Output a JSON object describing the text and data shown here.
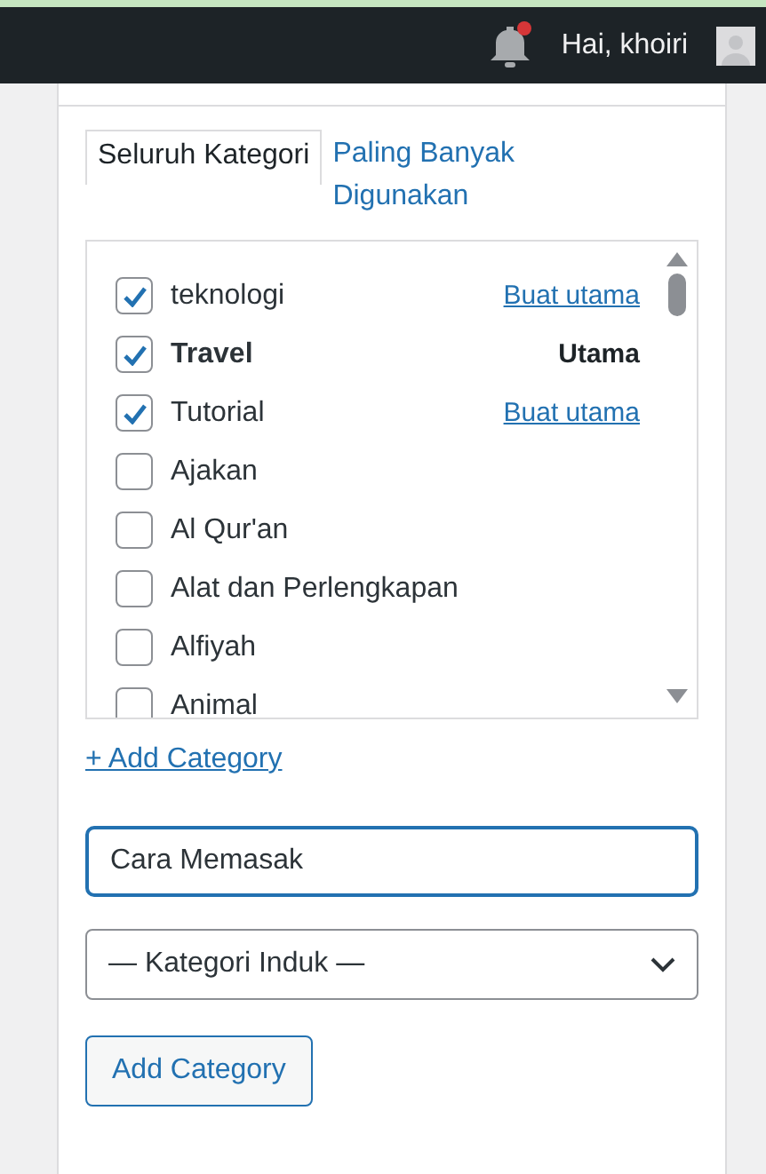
{
  "top_bar": {
    "greeting": "Hai, khoiri",
    "has_notification": true
  },
  "tabs": [
    {
      "label": "Seluruh Kategori",
      "selected": true
    },
    {
      "label": "Paling Banyak Digunakan",
      "selected": false
    }
  ],
  "categories": [
    {
      "label": "teknologi",
      "checked": true,
      "primary": false,
      "action": "Buat utama"
    },
    {
      "label": "Travel",
      "checked": true,
      "primary": true,
      "action": "Utama"
    },
    {
      "label": "Tutorial",
      "checked": true,
      "primary": false,
      "action": "Buat utama"
    },
    {
      "label": "Ajakan",
      "checked": false,
      "primary": false
    },
    {
      "label": "Al Qur'an",
      "checked": false,
      "primary": false
    },
    {
      "label": "Alat dan Perlengkapan",
      "checked": false,
      "primary": false
    },
    {
      "label": "Alfiyah",
      "checked": false,
      "primary": false
    },
    {
      "label": "Animal",
      "checked": false,
      "primary": false
    }
  ],
  "add_link": "+ Add Category",
  "new_category": {
    "value": "Cara Memasak"
  },
  "parent_select": {
    "value": "— Kategori Induk —"
  },
  "add_button": "Add Category"
}
